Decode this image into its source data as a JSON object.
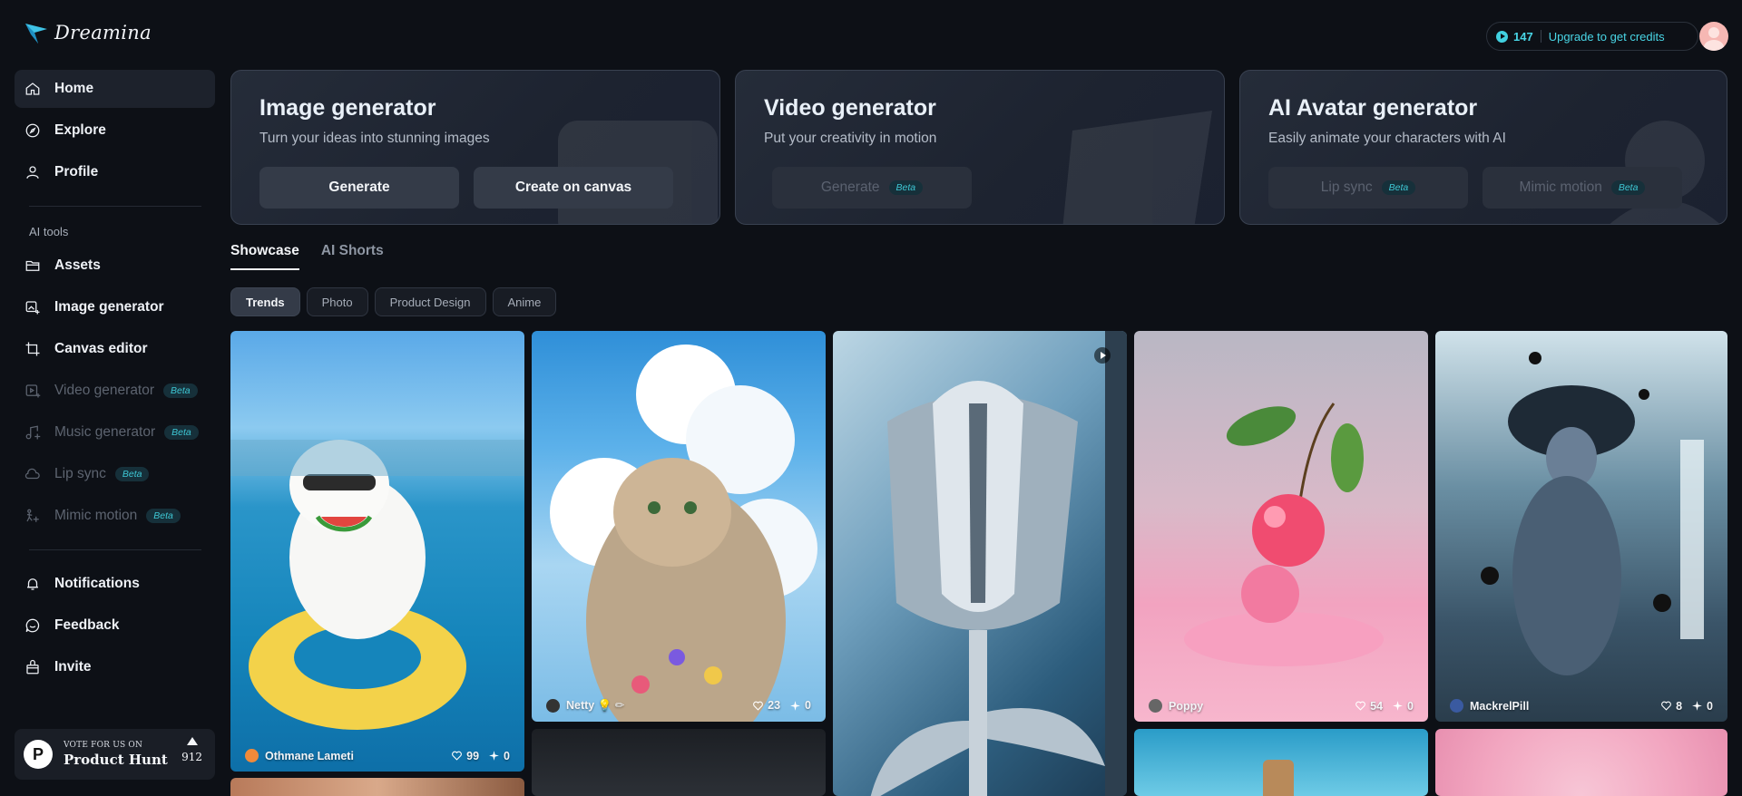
{
  "app": {
    "name": "Dreamina"
  },
  "sidebar": {
    "top_items": [
      {
        "label": "Home",
        "icon": "home-icon",
        "active": true
      },
      {
        "label": "Explore",
        "icon": "compass-icon"
      },
      {
        "label": "Profile",
        "icon": "user-icon"
      }
    ],
    "section_label": "AI tools",
    "tool_items": [
      {
        "label": "Assets",
        "icon": "folder-icon"
      },
      {
        "label": "Image generator",
        "icon": "image-plus-icon"
      },
      {
        "label": "Canvas editor",
        "icon": "crop-icon"
      },
      {
        "label": "Video generator",
        "icon": "video-icon",
        "beta": "Beta",
        "disabled": true
      },
      {
        "label": "Music generator",
        "icon": "music-icon",
        "beta": "Beta",
        "disabled": true
      },
      {
        "label": "Lip sync",
        "icon": "cloud-icon",
        "beta": "Beta",
        "disabled": true
      },
      {
        "label": "Mimic motion",
        "icon": "motion-icon",
        "beta": "Beta",
        "disabled": true
      }
    ],
    "bottom_items": [
      {
        "label": "Notifications",
        "icon": "bell-icon"
      },
      {
        "label": "Feedback",
        "icon": "feedback-icon"
      },
      {
        "label": "Invite",
        "icon": "gift-icon"
      }
    ],
    "product_hunt": {
      "small": "VOTE FOR US ON",
      "big": "Product Hunt",
      "votes": "912"
    }
  },
  "header": {
    "credits": "147",
    "upgrade": "Upgrade to get credits"
  },
  "cards": [
    {
      "title": "Image generator",
      "subtitle": "Turn your ideas into stunning images",
      "buttons": [
        {
          "label": "Generate"
        },
        {
          "label": "Create on canvas"
        }
      ]
    },
    {
      "title": "Video generator",
      "subtitle": "Put your creativity in motion",
      "buttons": [
        {
          "label": "Generate",
          "beta": "Beta",
          "disabled": true
        }
      ]
    },
    {
      "title": "AI Avatar generator",
      "subtitle": "Easily animate your characters with AI",
      "buttons": [
        {
          "label": "Lip sync",
          "beta": "Beta",
          "disabled": true
        },
        {
          "label": "Mimic motion",
          "beta": "Beta",
          "disabled": true
        }
      ]
    }
  ],
  "tabs": [
    {
      "label": "Showcase",
      "active": true
    },
    {
      "label": "AI Shorts"
    }
  ],
  "chips": [
    {
      "label": "Trends",
      "active": true
    },
    {
      "label": "Photo"
    },
    {
      "label": "Product Design"
    },
    {
      "label": "Anime"
    }
  ],
  "gallery": [
    {
      "user": "Othmane Lameti",
      "likes": "99",
      "remixes": "0",
      "theme": "cat-pool"
    },
    {
      "user": "Netty 💡 ✏",
      "likes": "23",
      "remixes": "0",
      "theme": "cat-clouds"
    },
    {
      "user": "",
      "likes": "",
      "remixes": "",
      "theme": "chrome-tulip",
      "video": true
    },
    {
      "user": "Poppy",
      "likes": "54",
      "remixes": "0",
      "theme": "cherry"
    },
    {
      "user": "MackrelPill",
      "likes": "8",
      "remixes": "0",
      "theme": "spider-queen"
    }
  ],
  "colors": {
    "accent": "#49d6e6",
    "background": "#0d1016",
    "beta_text": "#3ec7d4"
  }
}
